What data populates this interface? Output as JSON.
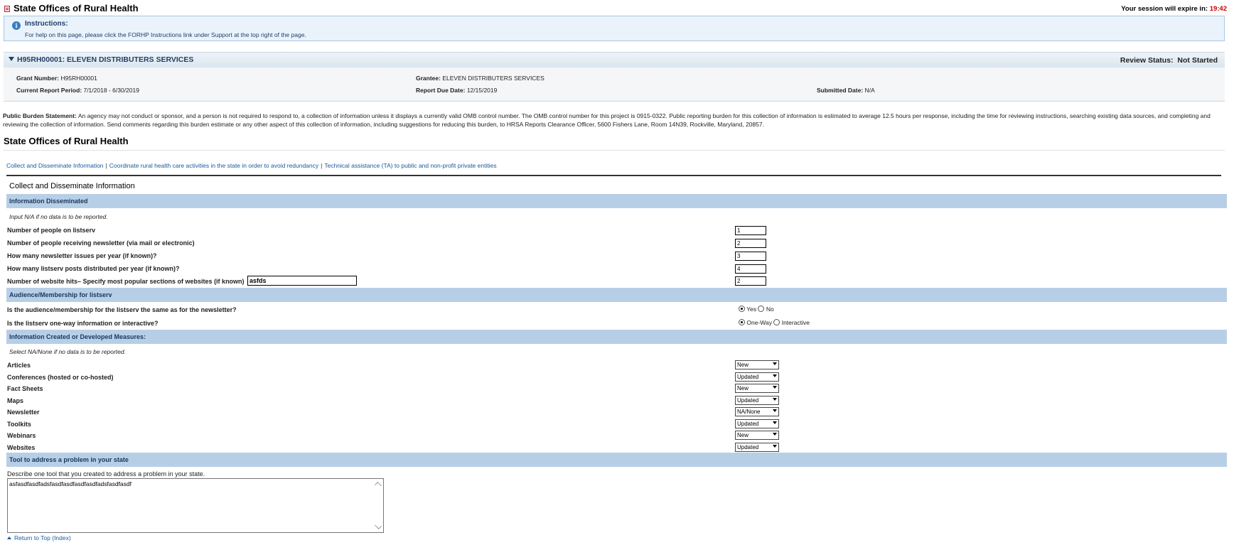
{
  "app": {
    "title": "State Offices of Rural Health",
    "session_prefix": "Your session will expire in: ",
    "session_time": "19:42"
  },
  "instructions": {
    "title": "Instructions:",
    "text": "For help on this page, please click the FORHP Instructions link under Support at the top right of the page."
  },
  "grant": {
    "title": "H95RH00001: ELEVEN DISTRIBUTERS SERVICES",
    "review_label": "Review Status:",
    "review_value": "Not Started",
    "grant_number_label": "Grant Number:",
    "grant_number": "H95RH00001",
    "grantee_label": "Grantee:",
    "grantee": "ELEVEN DISTRIBUTERS SERVICES",
    "period_label": "Current Report Period:",
    "period": "7/1/2018 - 6/30/2019",
    "due_label": "Report Due Date:",
    "due": "12/15/2019",
    "submitted_label": "Submitted Date:",
    "submitted": "N/A"
  },
  "burden": {
    "label": "Public Burden Statement:",
    "text": "An agency may not conduct or sponsor, and a person is not required to respond to, a collection of information unless it displays a currently valid OMB control number. The OMB control number for this project is 0915-0322. Public reporting burden for this collection of information is estimated to average 12.5 hours per response, including the time for reviewing instructions, searching existing data sources, and completing and reviewing the collection of information. Send comments regarding this burden estimate or any other aspect of this collection of information, including suggestions for reducing this burden, to HRSA Reports Clearance Officer, 5600 Fishers Lane, Room 14N39, Rockville, Maryland, 20857."
  },
  "page_heading": "State Offices of Rural Health",
  "nav_links": [
    "Collect and Disseminate Information",
    "Coordinate rural health care activities in the state in order to avoid redundancy",
    "Technical assistance (TA) to public and non-profit private entities"
  ],
  "nav_sep": "|",
  "section_title": "Collect and Disseminate Information",
  "info_disseminated": {
    "header": "Information Disseminated",
    "note": "Input N/A if no data is to be reported.",
    "rows": [
      {
        "label": "Number of people on listserv",
        "value": "1"
      },
      {
        "label": "Number of people receiving newsletter (via mail or electronic)",
        "value": "2"
      },
      {
        "label": "How many newsletter issues per year (if known)?",
        "value": "3"
      },
      {
        "label": "How many listserv posts distributed per year (if known)?",
        "value": "4"
      },
      {
        "label": "Number of website hits– Specify most popular sections of websites (if known)",
        "value": "2",
        "inline_value": "asfds"
      }
    ]
  },
  "audience": {
    "header": "Audience/Membership for listserv",
    "q1": "Is the audience/membership for the listserv the same as for the newsletter?",
    "q1_opt1": "Yes",
    "q1_opt2": "No",
    "q1_selected": "Yes",
    "q2": "Is the listserv one-way information or interactive?",
    "q2_opt1": "One-Way",
    "q2_opt2": "Interactive",
    "q2_selected": "One-Way"
  },
  "measures": {
    "header": "Information Created or Developed Measures:",
    "note": "Select NA/None if no data is to be reported.",
    "rows": [
      {
        "label": "Articles",
        "value": "New"
      },
      {
        "label": "Conferences (hosted or co-hosted)",
        "value": "Updated"
      },
      {
        "label": "Fact Sheets",
        "value": "New"
      },
      {
        "label": "Maps",
        "value": "Updated"
      },
      {
        "label": "Newsletter",
        "value": "NA/None"
      },
      {
        "label": "Toolkits",
        "value": "Updated"
      },
      {
        "label": "Webinars",
        "value": "New"
      },
      {
        "label": "Websites",
        "value": "Updated"
      }
    ]
  },
  "tool": {
    "header": "Tool to address a problem in your state",
    "prompt": "Describe one tool that you created to address a problem in your state.",
    "value": "asfasdfasdfadsfasdfasdfasdfasdfadsfasdfasdf"
  },
  "return_link": "Return to Top (Index)"
}
